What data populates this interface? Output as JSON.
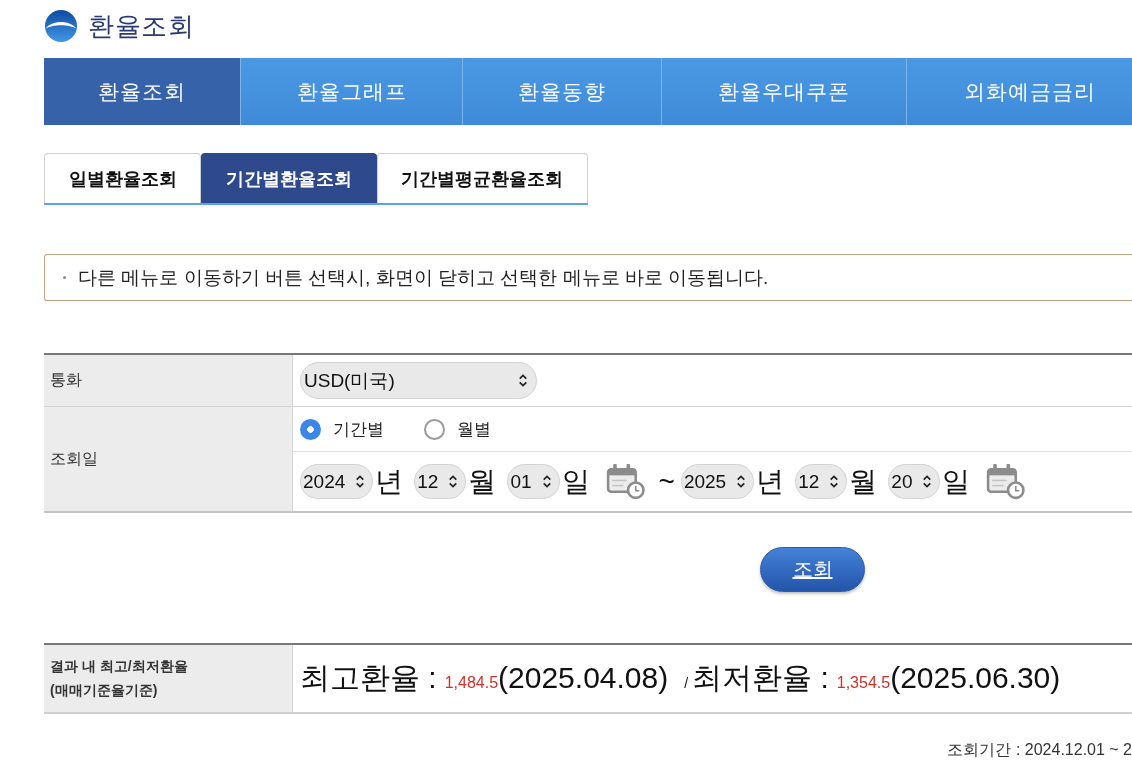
{
  "header": {
    "title": "환율조회"
  },
  "nav": [
    {
      "label": "환율조회",
      "selected": true
    },
    {
      "label": "환율그래프",
      "selected": false
    },
    {
      "label": "환율동향",
      "selected": false
    },
    {
      "label": "환율우대쿠폰",
      "selected": false
    },
    {
      "label": "외화예금금리",
      "selected": false
    }
  ],
  "subtabs": [
    {
      "label": "일별환율조회",
      "selected": false
    },
    {
      "label": "기간별환율조회",
      "selected": true
    },
    {
      "label": "기간별평균환율조회",
      "selected": false
    }
  ],
  "notice": "다른 메뉴로 이동하기 버튼 선택시, 화면이 닫히고 선택한 메뉴로 바로 이동됩니다.",
  "form": {
    "currency": {
      "label": "통화",
      "value": "USD(미국)"
    },
    "date": {
      "label": "조회일",
      "modes": [
        {
          "label": "기간별",
          "selected": true
        },
        {
          "label": "월별",
          "selected": false
        }
      ],
      "start": [
        {
          "value": "2024",
          "unit": "년"
        },
        {
          "value": "12",
          "unit": "월"
        },
        {
          "value": "01",
          "unit": "일"
        }
      ],
      "separator": "~",
      "end": [
        {
          "value": "2025",
          "unit": "년"
        },
        {
          "value": "12",
          "unit": "월"
        },
        {
          "value": "20",
          "unit": "일"
        }
      ]
    }
  },
  "search_button": "조회",
  "result": {
    "label_lines": [
      "결과 내 최고/최저환율",
      "(매매기준율기준)"
    ],
    "separator": "/",
    "items": [
      {
        "label": "최고환율 :",
        "value": "1,484.5",
        "date": "(2025.04.08)"
      },
      {
        "label": "최저환율 :",
        "value": "1,354.5",
        "date": "(2025.06.30)"
      }
    ]
  },
  "period": "조회기간 : 2024.12.01 ~ 2"
}
